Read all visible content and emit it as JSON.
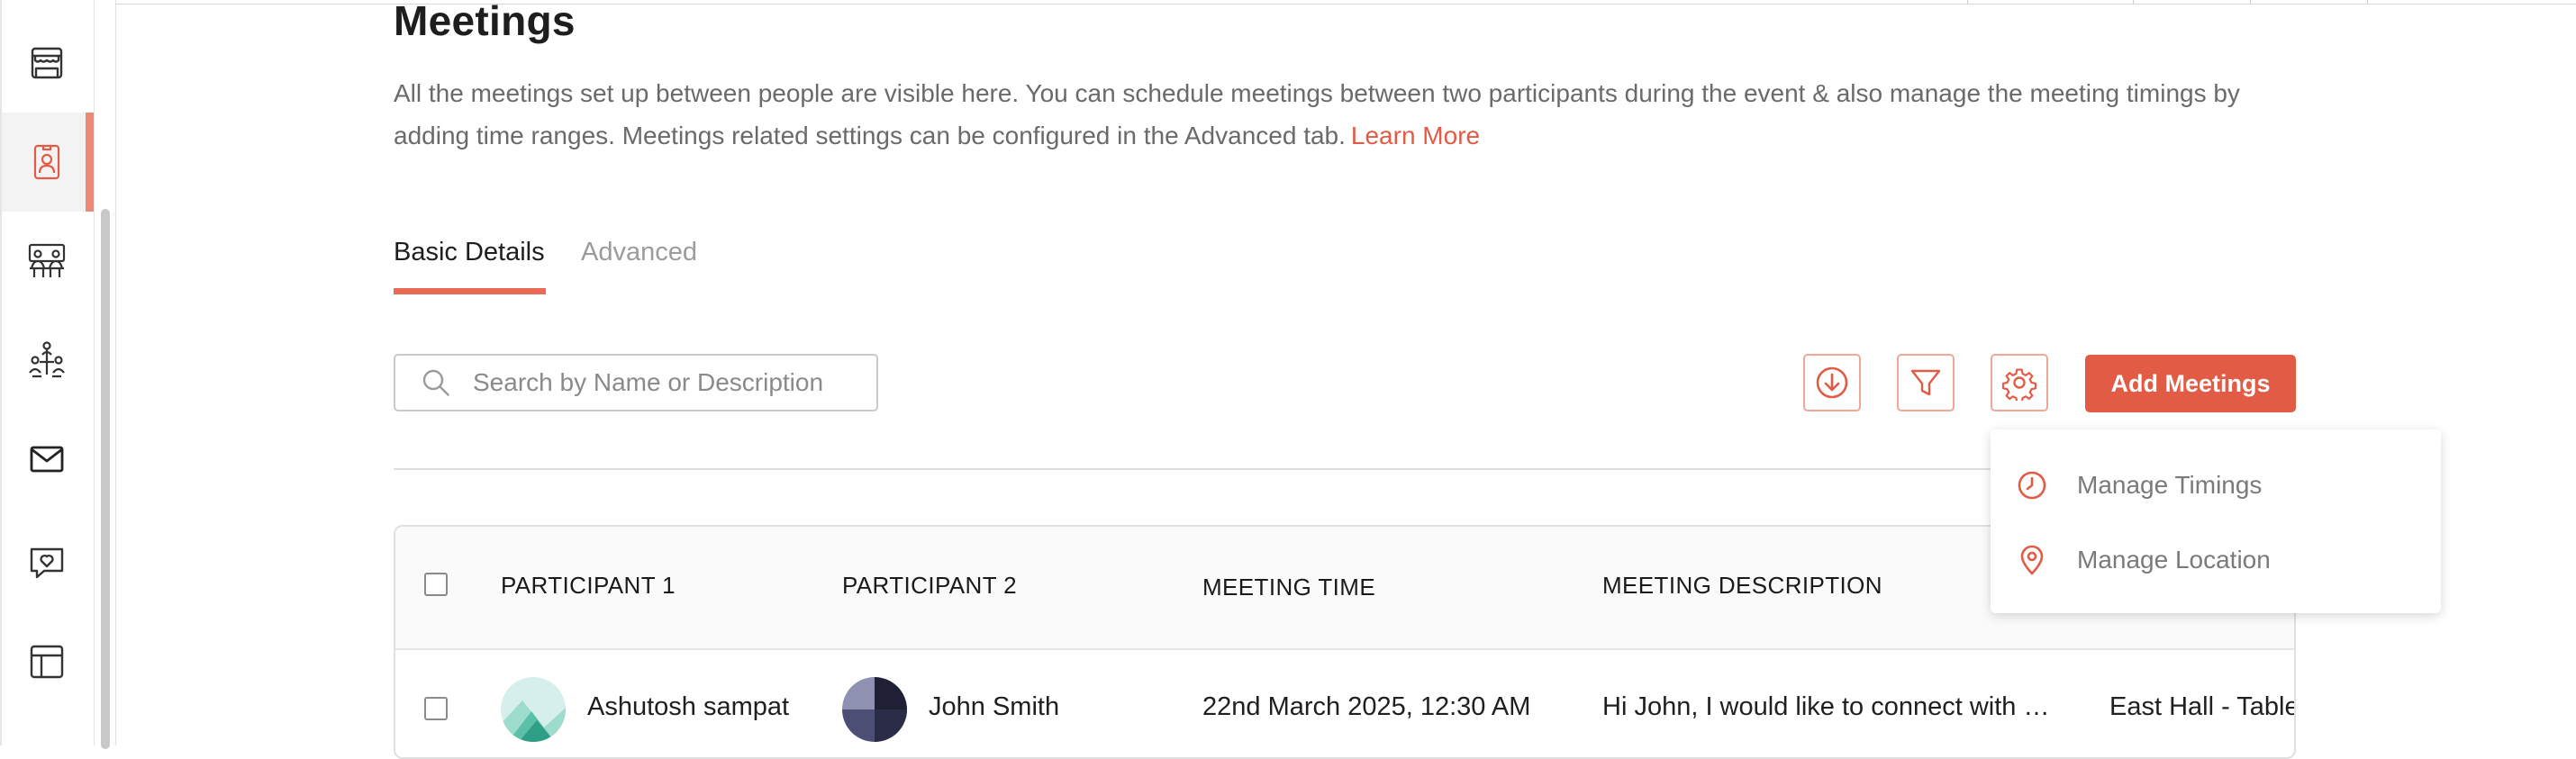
{
  "page": {
    "title": "Meetings",
    "description": "All the meetings set up between people are visible here. You can schedule meetings between two participants during the event & also manage the meeting timings by adding time ranges. Meetings related settings can be configured in the Advanced tab.",
    "learn_more": "Learn More"
  },
  "tabs": [
    {
      "label": "Basic Details",
      "active": true
    },
    {
      "label": "Advanced",
      "active": false
    }
  ],
  "search": {
    "placeholder": "Search by Name or Description",
    "value": ""
  },
  "toolbar": {
    "download_icon": "download-circle-icon",
    "filter_icon": "filter-icon",
    "settings_icon": "gear-icon",
    "add_label": "Add Meetings"
  },
  "dropdown": {
    "items": [
      {
        "label": "Manage Timings",
        "icon": "clock-icon"
      },
      {
        "label": "Manage Location",
        "icon": "location-pin-icon"
      }
    ]
  },
  "table": {
    "columns": [
      "PARTICIPANT 1",
      "PARTICIPANT 2",
      "MEETING TIME",
      "MEETING DESCRIPTION"
    ],
    "rows": [
      {
        "participant1": "Ashutosh sampat",
        "participant2": "John Smith",
        "meeting_time": "22nd March 2025, 12:30 AM",
        "description": "Hi John, I would like to connect with …",
        "location": "East Hall - Table"
      }
    ]
  },
  "sidebar": {
    "items": [
      {
        "icon": "storefront-icon",
        "active": false
      },
      {
        "icon": "attendee-badge-icon",
        "active": true
      },
      {
        "icon": "meeting-table-icon",
        "active": false
      },
      {
        "icon": "people-network-icon",
        "active": false
      },
      {
        "icon": "mail-icon",
        "active": false
      },
      {
        "icon": "chat-heart-icon",
        "active": false
      },
      {
        "icon": "layout-icon",
        "active": false
      }
    ]
  },
  "colors": {
    "accent": "#e25b45",
    "accent_light": "#f0a79a",
    "text_muted": "#6a6a6a"
  }
}
